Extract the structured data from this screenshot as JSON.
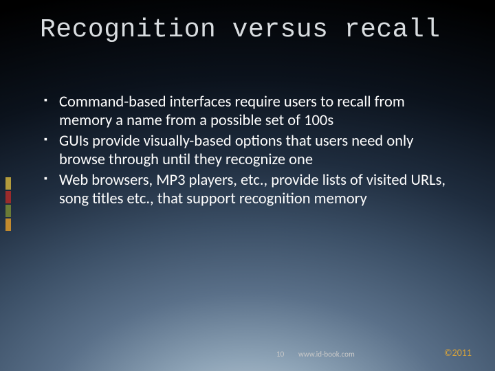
{
  "title": "Recognition versus recall",
  "bullets": [
    "Command-based interfaces require users to recall from memory a name from a possible set of 100s",
    "GUIs provide visually-based options that users need only browse through until they recognize one",
    "Web browsers, MP3 players, etc., provide lists of visited URLs, song titles etc., that support recognition memory"
  ],
  "footer": {
    "page": "10",
    "url": "www.id-book.com",
    "copyright": "©2011"
  }
}
